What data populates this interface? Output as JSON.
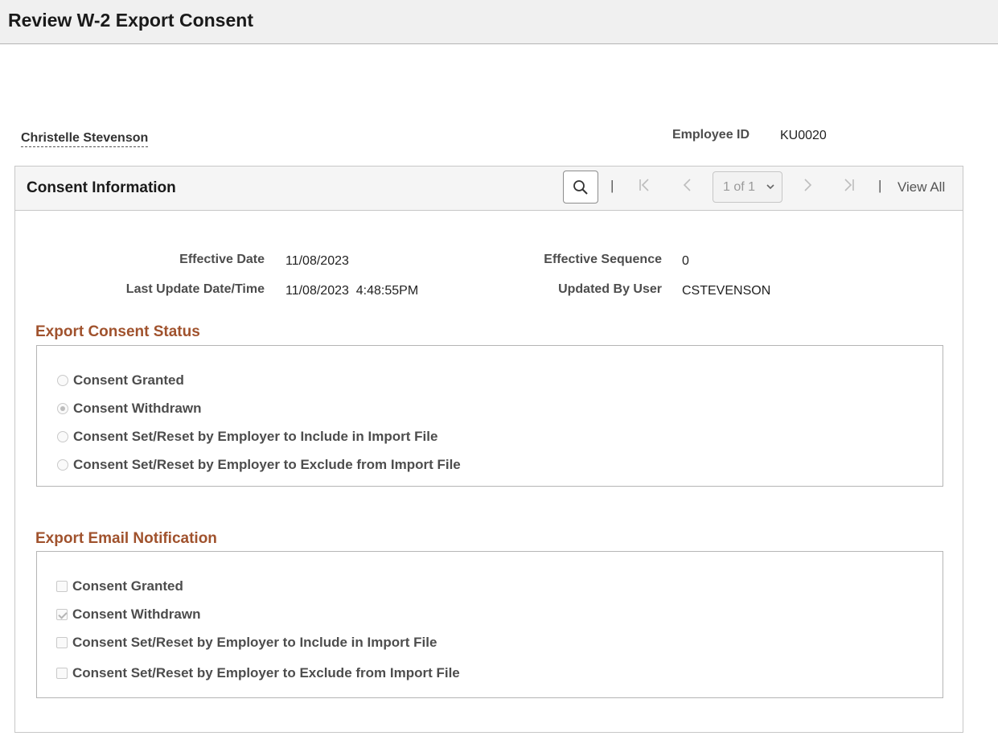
{
  "header": {
    "title": "Review W-2 Export Consent"
  },
  "employee": {
    "name": "Christelle Stevenson",
    "id_label": "Employee ID",
    "id_value": "KU0020"
  },
  "panel": {
    "title": "Consent Information",
    "pager": {
      "current": "1 of 1",
      "view_all": "View All"
    },
    "fields": {
      "effective_date_label": "Effective Date",
      "effective_date_value": "11/08/2023",
      "effective_seq_label": "Effective Sequence",
      "effective_seq_value": "0",
      "last_update_label": "Last Update Date/Time",
      "last_update_value": "11/08/2023  4:48:55PM",
      "updated_by_label": "Updated By User",
      "updated_by_value": "CSTEVENSON"
    }
  },
  "consent_status": {
    "title": "Export Consent Status",
    "options": [
      {
        "label": "Consent Granted",
        "selected": false
      },
      {
        "label": "Consent Withdrawn",
        "selected": true
      },
      {
        "label": "Consent Set/Reset by Employer to Include in Import File",
        "selected": false
      },
      {
        "label": "Consent Set/Reset by Employer to Exclude from Import File",
        "selected": false
      }
    ]
  },
  "email_notification": {
    "title": "Export Email Notification",
    "options": [
      {
        "label": "Consent Granted",
        "checked": false
      },
      {
        "label": "Consent Withdrawn",
        "checked": true
      },
      {
        "label": "Consent Set/Reset by Employer to Include in Import File",
        "checked": false
      },
      {
        "label": "Consent Set/Reset by Employer to Exclude from Import File",
        "checked": false
      }
    ]
  }
}
